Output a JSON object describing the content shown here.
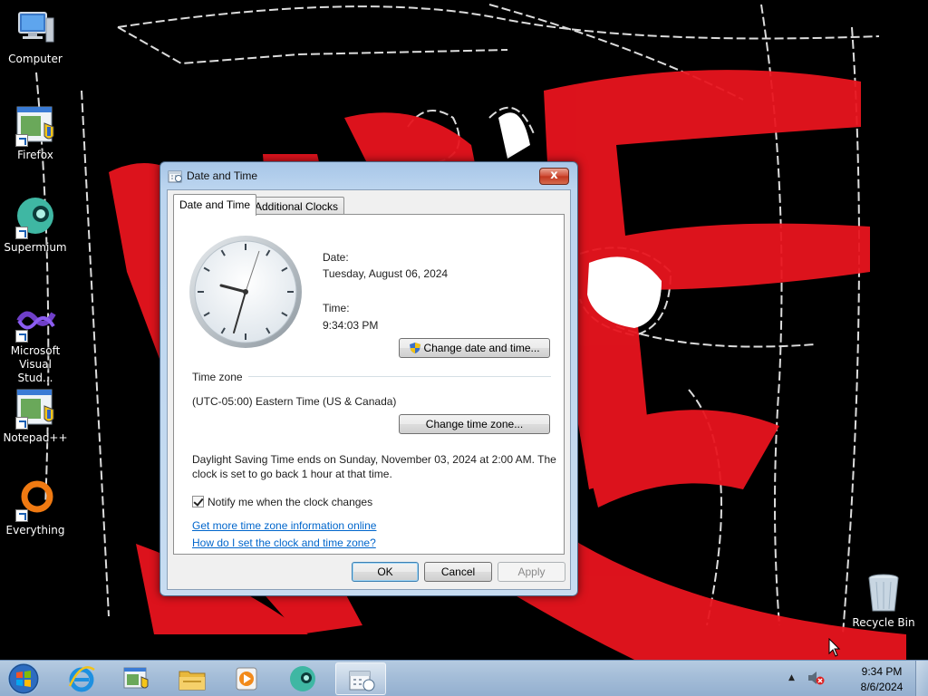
{
  "desktop": {
    "icons": [
      {
        "label": "Computer",
        "icon": "computer-icon"
      },
      {
        "label": "Firefox",
        "icon": "firefox-icon"
      },
      {
        "label": "Supermium",
        "icon": "supermium-icon"
      },
      {
        "label": "Microsoft Visual Stud...",
        "icon": "visual-studio-icon"
      },
      {
        "label": "Notepad++",
        "icon": "notepadpp-icon"
      },
      {
        "label": "Everything",
        "icon": "everything-icon"
      },
      {
        "label": "Recycle Bin",
        "icon": "recycle-bin-icon"
      }
    ]
  },
  "dialog": {
    "title": "Date and Time",
    "close_label": "x",
    "tabs": [
      {
        "label": "Date and Time",
        "selected": true
      },
      {
        "label": "Additional Clocks",
        "selected": false
      }
    ],
    "date_label": "Date:",
    "date_value": "Tuesday, August 06, 2024",
    "time_label": "Time:",
    "time_value": "9:34:03 PM",
    "change_datetime_button": "Change date and time...",
    "timezone_header": "Time zone",
    "timezone_value": "(UTC-05:00) Eastern Time (US & Canada)",
    "change_timezone_button": "Change time zone...",
    "dst_line1": "Daylight Saving Time ends on Sunday, November 03, 2024 at 2:00 AM. The",
    "dst_line2": "clock is set to go back 1 hour at that time.",
    "notify_label": "Notify me when the clock changes",
    "notify_checked": true,
    "link_more_info": "Get more time zone information online",
    "link_how_to": "How do I set the clock and time zone?",
    "ok_label": "OK",
    "cancel_label": "Cancel",
    "apply_label": "Apply"
  },
  "taskbar": {
    "apps": [
      "internet-explorer-icon",
      "control-panel-icon",
      "file-explorer-icon",
      "media-player-icon",
      "supermium-icon",
      "date-time-icon"
    ],
    "clock_time": "9:34 PM",
    "clock_date": "8/6/2024"
  },
  "colors": {
    "wallpaper_red": "#e8141e",
    "taskbar": "#a4bdd8",
    "link": "#0066cc"
  }
}
